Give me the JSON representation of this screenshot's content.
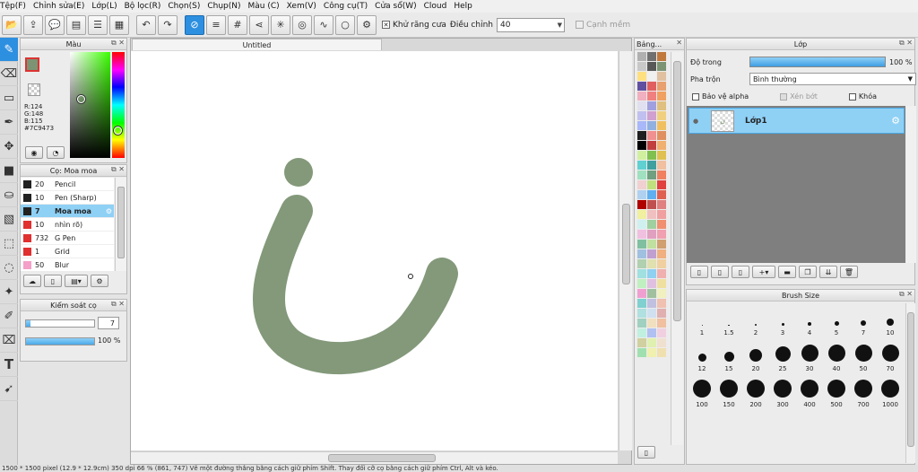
{
  "menu": [
    "Tệp(F)",
    "Chỉnh sửa(E)",
    "Lớp(L)",
    "Bộ lọc(R)",
    "Chọn(S)",
    "Chụp(N)",
    "Màu (C)",
    "Xem(V)",
    "Công cụ(T)",
    "Cửa sổ(W)",
    "Cloud",
    "Help"
  ],
  "toolbar": {
    "antialias_label": "Khử răng cưa",
    "adjust_label": "Điều chỉnh",
    "adjust_value": "40",
    "smooth_label": "Cạnh mềm"
  },
  "color_panel": {
    "title": "Màu",
    "r": "R:124",
    "g": "G:148",
    "b": "B:115",
    "hex": "#7C9473",
    "current_color": "#7C9473"
  },
  "brush_panel": {
    "title": "Cọ: Moa moa",
    "brushes": [
      {
        "size": "20",
        "name": "Pencil",
        "color": "#222222"
      },
      {
        "size": "10",
        "name": "Pen (Sharp)",
        "color": "#222222"
      },
      {
        "size": "7",
        "name": "Moa moa",
        "color": "#222222"
      },
      {
        "size": "10",
        "name": "nhìn rõ)",
        "color": "#e03030"
      },
      {
        "size": "732",
        "name": "G Pen",
        "color": "#e03030"
      },
      {
        "size": "1",
        "name": "Grid",
        "color": "#e03030"
      },
      {
        "size": "50",
        "name": "Blur",
        "color": "#f4a0c8"
      }
    ]
  },
  "brush_control": {
    "title": "Kiểm soát cọ",
    "size_value": "7",
    "opacity_value": "100 %",
    "size_fraction": 0.07,
    "opacity_fraction": 1.0
  },
  "canvas": {
    "tab_title": "Untitled",
    "stroke_color": "#7C9473"
  },
  "palette": {
    "title": "Bảng...",
    "colors": [
      "#b0b0b0",
      "#707070",
      "#c0783c",
      "#c8c8c8",
      "#585858",
      "#7C9473",
      "#ffe080",
      "#f0f0f0",
      "#e0c0a0",
      "#6050a0",
      "#e06060",
      "#e8a070",
      "#f0b0c0",
      "#f08080",
      "#f0a060",
      "#e0e0f0",
      "#a0a0e0",
      "#e0c080",
      "#c0c0f0",
      "#d0a0d0",
      "#f0d080",
      "#a8b8f8",
      "#90b0e0",
      "#f0c060",
      "#202020",
      "#f09090",
      "#e09060",
      "#000000",
      "#c04040",
      "#f0b070",
      "#d0f0a0",
      "#80c050",
      "#e0c050",
      "#60d0d0",
      "#40a0a0",
      "#f0c0a0",
      "#a0e0c0",
      "#70a080",
      "#f08060",
      "#f0d0d0",
      "#c0e080",
      "#e04040",
      "#b0d0f0",
      "#60b0f0",
      "#e06050",
      "#b00000",
      "#c05050",
      "#e08080",
      "#f0f0a0",
      "#f0c0c0",
      "#f0a0a0",
      "#d0f0f0",
      "#a0d0a0",
      "#f09070",
      "#f0c0e0",
      "#e0a0c0",
      "#f0a0b0",
      "#80c0a0",
      "#c0e0a0",
      "#d0a070",
      "#a0c0e0",
      "#c0a0d0",
      "#f0b080",
      "#b0d0b0",
      "#e0e0b0",
      "#f0d0a0",
      "#a0e0e0",
      "#90d0f0",
      "#f0b0b0",
      "#c0f0c0",
      "#e0c0e0",
      "#f0e0a0",
      "#f0a0d0",
      "#a0c0a0",
      "#f0f0c0",
      "#80d0d0",
      "#c0c0e0",
      "#f0c0b0",
      "#b0e0e0",
      "#d0e0f0",
      "#e0b0b0",
      "#a0d0c0",
      "#f0e0c0",
      "#f0c0a0",
      "#c0f0e0",
      "#b0c0f0",
      "#f0d0e0",
      "#d0d0a0",
      "#e0f0b0",
      "#f0e0d0",
      "#a0e0b0",
      "#f0f0b0",
      "#f0e0b0"
    ]
  },
  "layer_panel": {
    "title": "Lớp",
    "opacity_label": "Độ trong",
    "opacity_value": "100 %",
    "opacity_fraction": 1.0,
    "blend_label": "Pha trộn",
    "blend_value": "Bình thường",
    "protect_alpha": "Bảo vệ alpha",
    "clipping": "Xén bớt",
    "lock": "Khóa",
    "layers": [
      {
        "name": "Lớp1"
      }
    ]
  },
  "brush_size_panel": {
    "title": "Brush Size",
    "sizes": [
      {
        "label": "1",
        "d": 1
      },
      {
        "label": "1.5",
        "d": 1.5
      },
      {
        "label": "2",
        "d": 2
      },
      {
        "label": "3",
        "d": 3
      },
      {
        "label": "4",
        "d": 4
      },
      {
        "label": "5",
        "d": 5
      },
      {
        "label": "7",
        "d": 6
      },
      {
        "label": "10",
        "d": 8
      },
      {
        "label": "12",
        "d": 9
      },
      {
        "label": "15",
        "d": 11
      },
      {
        "label": "20",
        "d": 14
      },
      {
        "label": "25",
        "d": 17
      },
      {
        "label": "30",
        "d": 19
      },
      {
        "label": "40",
        "d": 19
      },
      {
        "label": "50",
        "d": 19
      },
      {
        "label": "70",
        "d": 19
      },
      {
        "label": "100",
        "d": 20
      },
      {
        "label": "150",
        "d": 20
      },
      {
        "label": "200",
        "d": 20
      },
      {
        "label": "300",
        "d": 20
      },
      {
        "label": "400",
        "d": 20
      },
      {
        "label": "500",
        "d": 20
      },
      {
        "label": "700",
        "d": 20
      },
      {
        "label": "1000",
        "d": 20
      }
    ]
  },
  "status": "1500 * 1500 pixel (12.9 * 12.9cm) 350 dpi 66 % (861, 747) Vẽ một đường thẳng bằng cách giữ phím Shift. Thay đổi cỡ cọ bằng cách giữ phím Ctrl, Alt và kéo."
}
